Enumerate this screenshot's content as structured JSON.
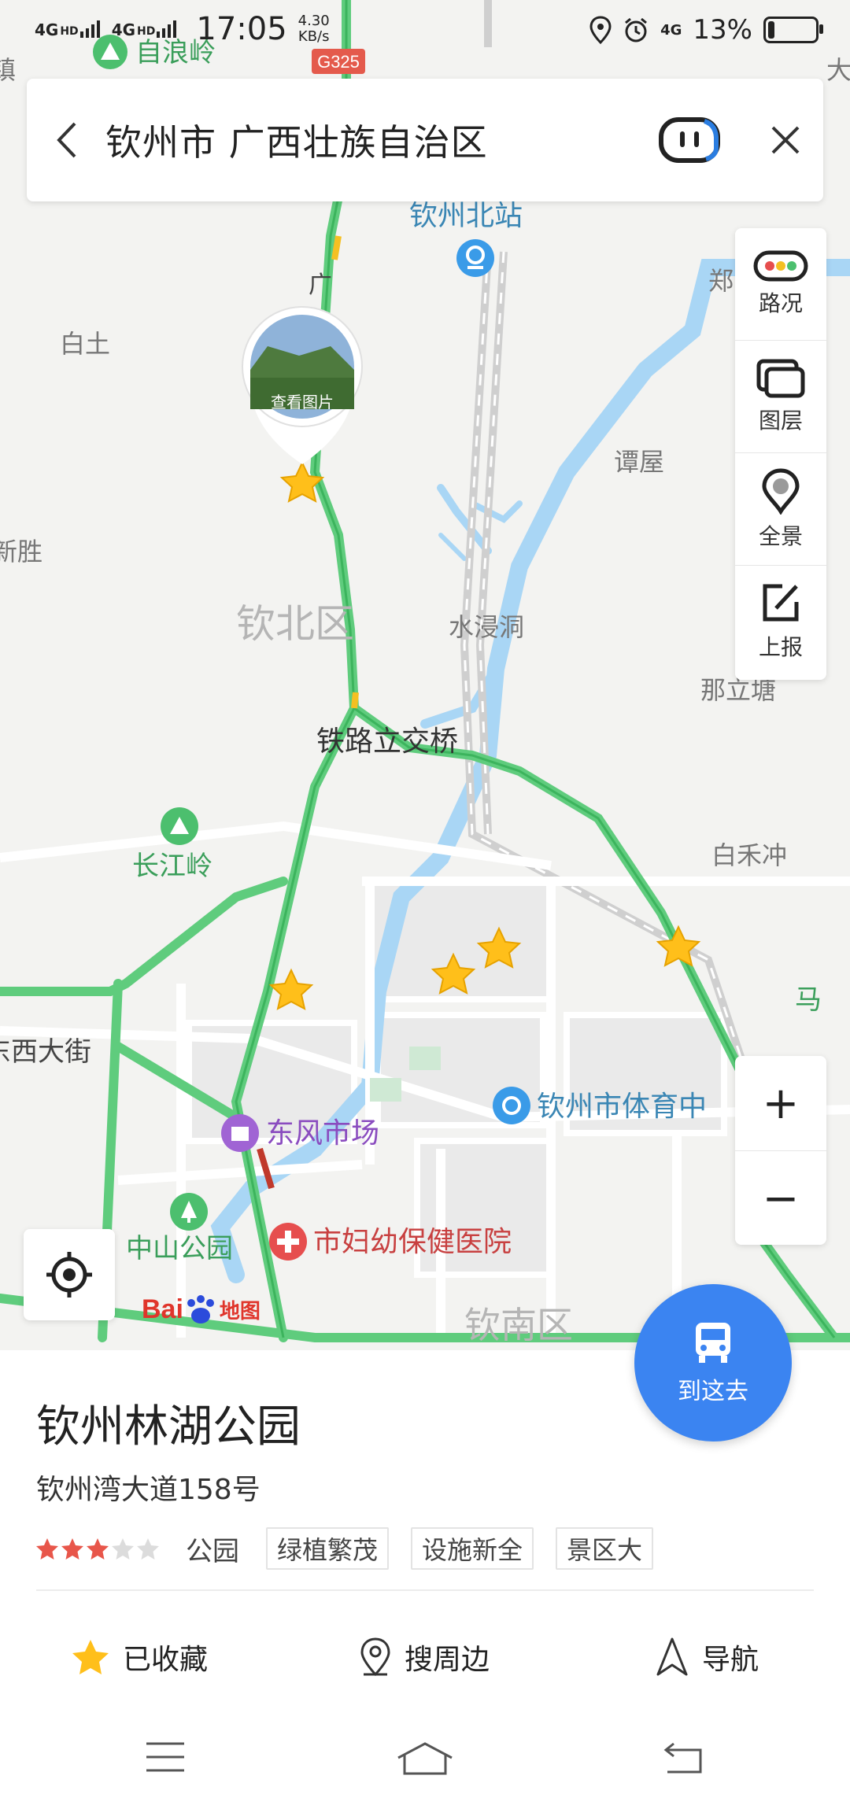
{
  "status_bar": {
    "network1": "4G",
    "network2": "4G",
    "hd1": "HD",
    "hd2": "HD",
    "time": "17:05",
    "speed_value": "4.30",
    "speed_unit": "KB/s",
    "battery": "13%",
    "battery_level": 0.13,
    "net3": "4G"
  },
  "search": {
    "query": "钦州市 广西壮族自治区"
  },
  "tools": [
    {
      "label": "路况",
      "icon": "traffic-icon"
    },
    {
      "label": "图层",
      "icon": "layers-icon"
    },
    {
      "label": "全景",
      "icon": "panorama-icon"
    },
    {
      "label": "上报",
      "icon": "report-icon"
    }
  ],
  "map": {
    "photo_caption": "查看图片",
    "labels": {
      "zilangling": "自浪岭",
      "g325": "G325",
      "north_station": "钦州北站",
      "guang": "广",
      "baitu": "白土",
      "zheng": "郑",
      "tanwu": "谭屋",
      "xinsheng": "新胜",
      "qinbei": "钦北区",
      "shuijindong": "水浸洞",
      "naliting": "那立塘",
      "tielu": "铁路立交桥",
      "changjiangling": "长江岭",
      "baihechong": "白禾冲",
      "ma": "马",
      "xidajie": "东西大街",
      "stadium": "钦州市体育中",
      "dongfeng": "东风市场",
      "zhongshan": "中山公园",
      "hospital": "市妇幼保健医院",
      "qinnan": "钦南区",
      "da": "大",
      "zhen": "镇"
    },
    "logo_bai": "Bai",
    "logo_du": "du",
    "logo_map": "地图",
    "zoom_in": "+",
    "zoom_out": "−"
  },
  "go_button": {
    "label": "到这去"
  },
  "place": {
    "name": "钦州林湖公园",
    "address": "钦州湾大道158号",
    "rating": 3,
    "rating_max": 5,
    "category": "公园",
    "tags": [
      "绿植繁茂",
      "设施新全",
      "景区大"
    ]
  },
  "actions": {
    "favorite": "已收藏",
    "nearby": "搜周边",
    "navigate": "导航"
  },
  "colors": {
    "road_green": "#5fcc7d",
    "accent_blue": "#3b84f1",
    "water": "#a9d6f5",
    "star": "#ffbf1a"
  }
}
